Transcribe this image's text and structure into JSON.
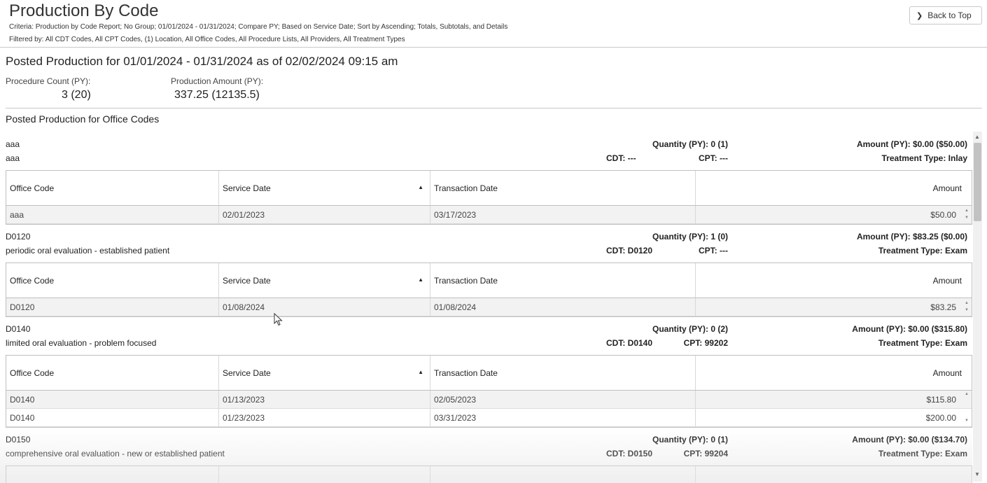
{
  "header": {
    "title": "Production By Code",
    "criteria": "Criteria: Production by Code Report; No Group; 01/01/2024 - 01/31/2024; Compare PY; Based on Service Date; Sort by Ascending; Totals, Subtotals, and Details",
    "filtered": "Filtered by: All CDT Codes, All CPT Codes, (1) Location, All Office Codes, All Procedure Lists, All Providers, All Treatment Types",
    "back_label": "Back to Top"
  },
  "summary": {
    "title": "Posted Production for 01/01/2024 - 01/31/2024 as of 02/02/2024 09:15 am",
    "procedure_count_label": "Procedure Count (PY):",
    "procedure_count_value": "3 (20)",
    "production_amount_label": "Production Amount (PY):",
    "production_amount_value": "337.25 (12135.5)"
  },
  "section_title": "Posted Production for Office Codes",
  "columns": {
    "office_code": "Office Code",
    "service_date": "Service Date",
    "transaction_date": "Transaction Date",
    "amount": "Amount"
  },
  "codes": [
    {
      "code": "aaa",
      "description": "aaa",
      "quantity": "Quantity (PY): 0 (1)",
      "cdt": "CDT: ---",
      "cpt": "CPT: ---",
      "amount_py": "Amount (PY): $0.00 ($50.00)",
      "treatment_type": "Treatment Type: Inlay",
      "rows": [
        {
          "office_code": "aaa",
          "service_date": "02/01/2023",
          "transaction_date": "03/17/2023",
          "amount": "$50.00"
        }
      ]
    },
    {
      "code": "D0120",
      "description": "periodic oral evaluation - established patient",
      "quantity": "Quantity (PY): 1 (0)",
      "cdt": "CDT: D0120",
      "cpt": "CPT: ---",
      "amount_py": "Amount (PY): $83.25 ($0.00)",
      "treatment_type": "Treatment Type: Exam",
      "rows": [
        {
          "office_code": "D0120",
          "service_date": "01/08/2024",
          "transaction_date": "01/08/2024",
          "amount": "$83.25"
        }
      ]
    },
    {
      "code": "D0140",
      "description": "limited oral evaluation - problem focused",
      "quantity": "Quantity (PY): 0 (2)",
      "cdt": "CDT: D0140",
      "cpt": "CPT: 99202",
      "amount_py": "Amount (PY): $0.00 ($315.80)",
      "treatment_type": "Treatment Type: Exam",
      "rows": [
        {
          "office_code": "D0140",
          "service_date": "01/13/2023",
          "transaction_date": "02/05/2023",
          "amount": "$115.80"
        },
        {
          "office_code": "D0140",
          "service_date": "01/23/2023",
          "transaction_date": "03/31/2023",
          "amount": "$200.00"
        }
      ]
    },
    {
      "code": "D0150",
      "description": "comprehensive oral evaluation - new or established patient",
      "quantity": "Quantity (PY): 0 (1)",
      "cdt": "CDT: D0150",
      "cpt": "CPT: 99204",
      "amount_py": "Amount (PY): $0.00 ($134.70)",
      "treatment_type": "Treatment Type: Exam",
      "rows": []
    }
  ]
}
